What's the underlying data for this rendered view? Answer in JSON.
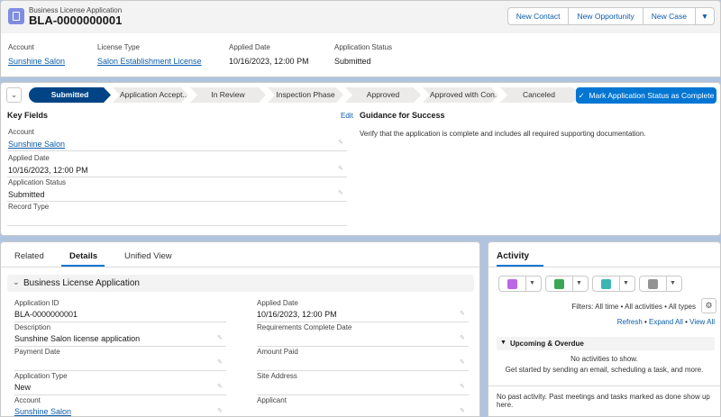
{
  "header": {
    "object_label": "Business License Application",
    "title": "BLA-0000000001",
    "buttons": [
      "New Contact",
      "New Opportunity",
      "New Case"
    ],
    "fields": [
      {
        "label": "Account",
        "value": "Sunshine Salon"
      },
      {
        "label": "License Type",
        "value": "Salon Establishment License"
      },
      {
        "label": "Applied Date",
        "value": "10/16/2023, 12:00 PM"
      },
      {
        "label": "Application Status",
        "value": "Submitted"
      }
    ]
  },
  "path": {
    "stages": [
      "Submitted",
      "Application Accept...",
      "In Review",
      "Inspection Phase",
      "Approved",
      "Approved with Con...",
      "Canceled"
    ],
    "current_stage": "Submitted",
    "mark_button": "Mark Application Status as Complete",
    "key_fields_title": "Key Fields",
    "edit_label": "Edit",
    "key_fields": [
      {
        "label": "Account",
        "value": "Sunshine Salon"
      },
      {
        "label": "Applied Date",
        "value": "10/16/2023, 12:00 PM"
      },
      {
        "label": "Application Status",
        "value": "Submitted"
      },
      {
        "label": "Record Type",
        "value": ""
      }
    ],
    "guidance_title": "Guidance for Success",
    "guidance_text": "Verify that the application is complete and includes all required supporting documentation."
  },
  "details": {
    "tabs": [
      "Related",
      "Details",
      "Unified View"
    ],
    "active_tab": "Details",
    "section_title": "Business License Application",
    "left_fields": [
      {
        "label": "Application ID",
        "value": "BLA-0000000001"
      },
      {
        "label": "Description",
        "value": "Sunshine Salon license application"
      },
      {
        "label": "Payment Date",
        "value": ""
      },
      {
        "label": "Application Type",
        "value": "New"
      },
      {
        "label": "Account",
        "value": "Sunshine Salon"
      }
    ],
    "right_fields": [
      {
        "label": "Applied Date",
        "value": "10/16/2023, 12:00 PM"
      },
      {
        "label": "Requirements Complete Date",
        "value": ""
      },
      {
        "label": "Amount Paid",
        "value": ""
      },
      {
        "label": "Site Address",
        "value": ""
      },
      {
        "label": "Applicant",
        "value": ""
      }
    ]
  },
  "activity": {
    "tab": "Activity",
    "action_colors": [
      "#ba67e7",
      "#3ba755",
      "#3bb6b0",
      "#939393"
    ],
    "filters": "Filters: All time • All activities • All types",
    "links": [
      "Refresh",
      "Expand All",
      "View All"
    ],
    "upcoming_title": "Upcoming & Overdue",
    "no_activities": "No activities to show.",
    "get_started": "Get started by sending an email, scheduling a task, and more.",
    "past_activity": "No past activity. Past meetings and tasks marked as done show up here."
  }
}
